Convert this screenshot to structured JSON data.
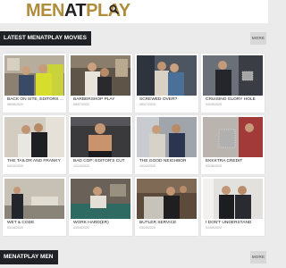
{
  "header": {
    "logo_part1": "MEN",
    "logo_part2": "AT",
    "logo_part3": "PLAY",
    "search_icon": "search-icon"
  },
  "sections": {
    "latest": {
      "title": "LATEST MENATPLAY MOVIES",
      "more_label": "MORE"
    },
    "men": {
      "title": "MENATPLAY MEN",
      "more_label": "MORE"
    }
  },
  "movies": [
    {
      "title": "BACK ON SITE, EDITORS ...",
      "date": "08/06/2020"
    },
    {
      "title": "BARBERSHOP PLAY",
      "date": "08/07/2020"
    },
    {
      "title": "SCREWED OVER?",
      "date": "08/07/2020"
    },
    {
      "title": "CRUISING GLORY HOLE",
      "date": "04/28/2020"
    },
    {
      "title": "THE TAILOR AND FRANKY",
      "date": "04/10/2020"
    },
    {
      "title": "BAD COP: EDITOR'S CUT",
      "date": "12/24/2020"
    },
    {
      "title": "THE GOOD NEIGHBOR",
      "date": "10/24/2020"
    },
    {
      "title": "EKKKTRA CREDIT",
      "date": "03/26/2020"
    },
    {
      "title": "WET & CODE",
      "date": "03/18/2020"
    },
    {
      "title": "WORK HARD(ER)",
      "date": "03/04/2020"
    },
    {
      "title": "BUTLER SERVICE",
      "date": "03/25/2020"
    },
    {
      "title": "I DON'T UNDERSTAND",
      "date": "01/05/2020"
    }
  ],
  "colors": {
    "brand_gold": "#b08d3c",
    "brand_dark": "#231f20",
    "bar_bg": "#1f2127",
    "page_bg": "#ebebeb"
  }
}
